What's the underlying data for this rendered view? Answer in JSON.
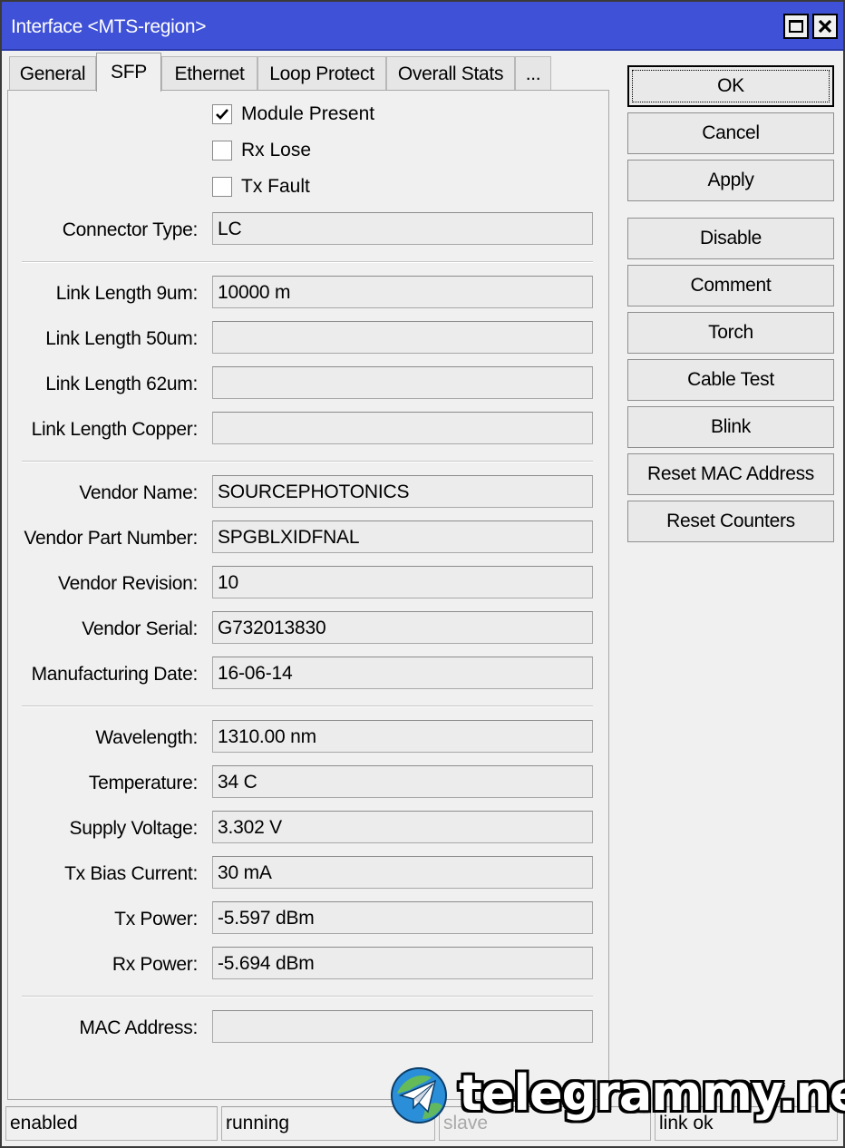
{
  "window": {
    "title": "Interface <MTS-region>"
  },
  "tabs": [
    {
      "label": "General"
    },
    {
      "label": "SFP"
    },
    {
      "label": "Ethernet"
    },
    {
      "label": "Loop Protect"
    },
    {
      "label": "Overall Stats"
    },
    {
      "label": "..."
    }
  ],
  "checkboxes": {
    "module_present": {
      "label": "Module Present",
      "checked": true
    },
    "rx_lose": {
      "label": "Rx Lose",
      "checked": false
    },
    "tx_fault": {
      "label": "Tx Fault",
      "checked": false
    }
  },
  "fields": {
    "connector_type": {
      "label": "Connector Type:",
      "value": "LC"
    },
    "link_length_9um": {
      "label": "Link Length 9um:",
      "value": "10000 m"
    },
    "link_length_50um": {
      "label": "Link Length 50um:",
      "value": ""
    },
    "link_length_62um": {
      "label": "Link Length 62um:",
      "value": ""
    },
    "link_length_copper": {
      "label": "Link Length Copper:",
      "value": ""
    },
    "vendor_name": {
      "label": "Vendor Name:",
      "value": "SOURCEPHOTONICS"
    },
    "vendor_part_number": {
      "label": "Vendor Part Number:",
      "value": "SPGBLXIDFNAL"
    },
    "vendor_revision": {
      "label": "Vendor Revision:",
      "value": "10"
    },
    "vendor_serial": {
      "label": "Vendor Serial:",
      "value": "G732013830"
    },
    "manufacturing_date": {
      "label": "Manufacturing Date:",
      "value": "16-06-14"
    },
    "wavelength": {
      "label": "Wavelength:",
      "value": "1310.00 nm"
    },
    "temperature": {
      "label": "Temperature:",
      "value": "34 C"
    },
    "supply_voltage": {
      "label": "Supply Voltage:",
      "value": "3.302 V"
    },
    "tx_bias_current": {
      "label": "Tx Bias Current:",
      "value": "30 mA"
    },
    "tx_power": {
      "label": "Tx Power:",
      "value": "-5.597 dBm"
    },
    "rx_power": {
      "label": "Rx Power:",
      "value": "-5.694 dBm"
    },
    "mac_address": {
      "label": "MAC Address:",
      "value": ""
    }
  },
  "buttons": {
    "ok": "OK",
    "cancel": "Cancel",
    "apply": "Apply",
    "disable": "Disable",
    "comment": "Comment",
    "torch": "Torch",
    "cable_test": "Cable Test",
    "blink": "Blink",
    "reset_mac": "Reset MAC Address",
    "reset_counters": "Reset Counters"
  },
  "status": {
    "state": "enabled",
    "run": "running",
    "slave": "slave",
    "link": "link ok"
  },
  "watermark": {
    "text": "telegrammy.net"
  },
  "colors": {
    "titlebar": "#3f51d6",
    "background": "#f0f0f0"
  }
}
